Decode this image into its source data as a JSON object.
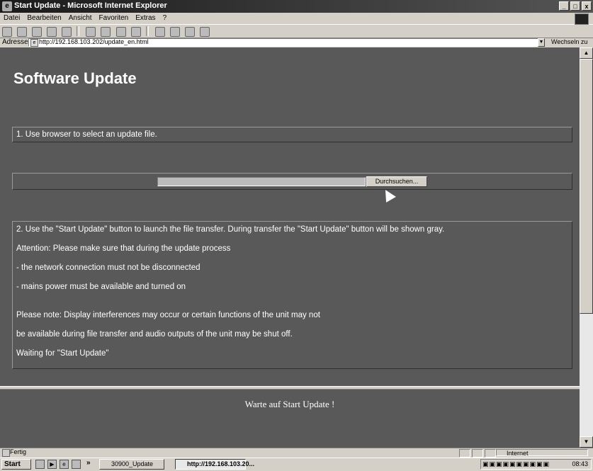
{
  "window": {
    "title": "Start Update - Microsoft Internet Explorer",
    "controls": [
      "_",
      "□",
      "x"
    ]
  },
  "menu": [
    "Datei",
    "Bearbeiten",
    "Ansicht",
    "Favoriten",
    "Extras",
    "?"
  ],
  "address": {
    "label": "Adresse",
    "url": "http://192.168.103.202/update_en.html",
    "go_label": "Wechseln zu"
  },
  "page": {
    "heading": "Software Update",
    "step1": "1. Use browser to select an update file.",
    "browse_label": "Durchsuchen...",
    "step2_lines": [
      "2. Use the \"Start Update\" button to launch the file transfer. During transfer the \"Start Update\" button will be shown gray.",
      "Attention: Please make sure that during the update process",
      "- the network connection must not be disconnected",
      "- mains power must be available and turned on",
      "Please note: Display interferences may occur or certain functions of the unit may not",
      "be available during file transfer and audio outputs of the unit may be shut off.",
      "Waiting for \"Start Update\""
    ],
    "bottom_status": "Warte auf Start Update !"
  },
  "statusbar": {
    "text": "Fertig",
    "zone": "Internet"
  },
  "taskbar": {
    "start": "Start",
    "more": "»",
    "tasks": [
      "30900_Update",
      "http://192.168.103.20..."
    ],
    "clock": "08:43"
  }
}
